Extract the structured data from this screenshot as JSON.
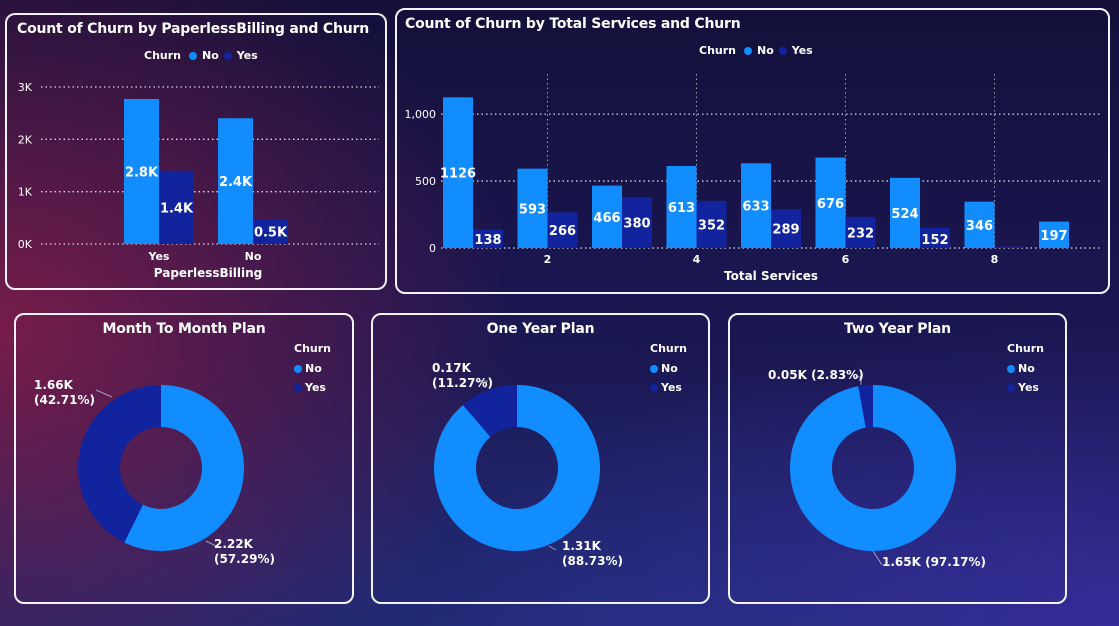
{
  "colors": {
    "no": "#118dff",
    "yes": "#12239e",
    "grid": "#d8d8e0"
  },
  "legend_title": "Churn",
  "chart_data": [
    {
      "type": "bar",
      "title": "Count of Churn by PaperlessBilling and Churn",
      "xlabel": "PaperlessBilling",
      "categories": [
        "Yes",
        "No"
      ],
      "series": [
        {
          "name": "No",
          "values": [
            2771,
            2403
          ],
          "labels": [
            "2.8K",
            "2.4K"
          ]
        },
        {
          "name": "Yes",
          "values": [
            1400,
            469
          ],
          "labels": [
            "1.4K",
            "0.5K"
          ]
        }
      ],
      "ylim": [
        0,
        3000
      ],
      "yticks": [
        0,
        1000,
        2000,
        3000
      ],
      "ytick_labels": [
        "0K",
        "1K",
        "2K",
        "3K"
      ],
      "grid": true
    },
    {
      "type": "bar",
      "title": "Count of Churn by Total Services and Churn",
      "xlabel": "Total Services",
      "categories": [
        1,
        2,
        3,
        4,
        5,
        6,
        7,
        8,
        9
      ],
      "xtick_labels": [
        "2",
        "4",
        "6",
        "8"
      ],
      "series": [
        {
          "name": "No",
          "values": [
            1126,
            593,
            466,
            613,
            633,
            676,
            524,
            346,
            197
          ]
        },
        {
          "name": "Yes",
          "values": [
            138,
            266,
            380,
            352,
            289,
            232,
            152,
            10,
            null
          ]
        }
      ],
      "data_labels": {
        "No": [
          "1126",
          "593",
          "466",
          "613",
          "633",
          "676",
          "524",
          "346",
          "197"
        ],
        "Yes": [
          "138",
          "266",
          "380",
          "352",
          "289",
          "232",
          "152",
          "",
          ""
        ]
      },
      "ylim": [
        0,
        1300
      ],
      "yticks": [
        0,
        500,
        1000
      ],
      "ytick_labels": [
        "0",
        "500",
        "1,000"
      ],
      "grid": true
    },
    {
      "type": "pie",
      "title": "Month To Month Plan",
      "series": [
        {
          "name": "No",
          "value": 2220,
          "label": "2.22K (57.29%)"
        },
        {
          "name": "Yes",
          "value": 1655,
          "label": "1.66K (42.71%)"
        }
      ]
    },
    {
      "type": "pie",
      "title": "One Year Plan",
      "series": [
        {
          "name": "No",
          "value": 1307,
          "label": "1.31K (88.73%)"
        },
        {
          "name": "Yes",
          "value": 166,
          "label": "0.17K (11.27%)"
        }
      ]
    },
    {
      "type": "pie",
      "title": "Two Year Plan",
      "series": [
        {
          "name": "No",
          "value": 1647,
          "label": "1.65K (97.17%)"
        },
        {
          "name": "Yes",
          "value": 48,
          "label": "0.05K (2.83%)"
        }
      ]
    }
  ]
}
